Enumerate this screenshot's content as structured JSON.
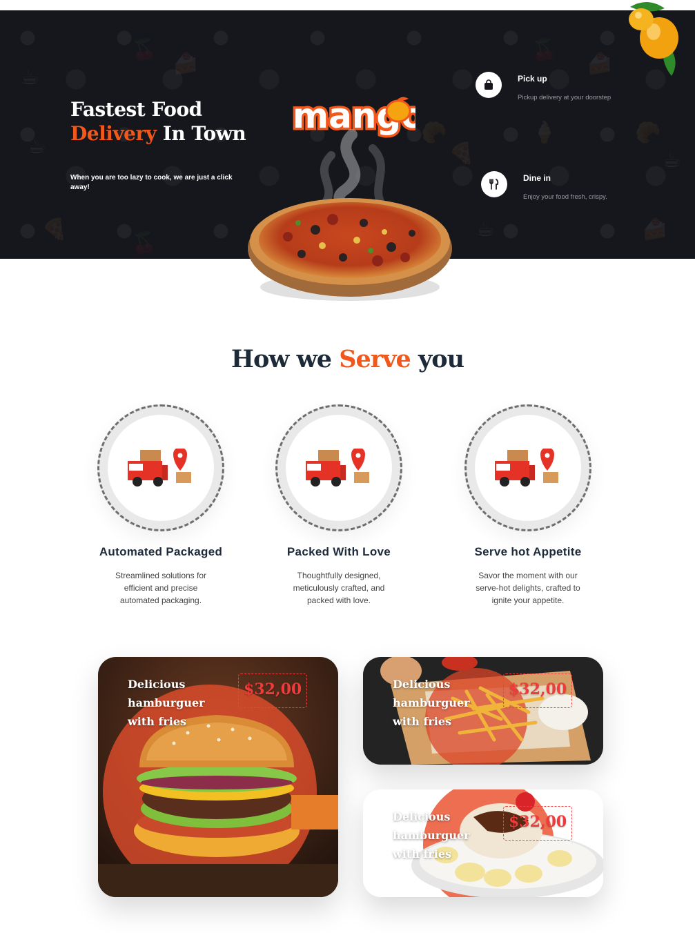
{
  "hero": {
    "title_line1": "Fastest Food",
    "title_accent": "Delivery",
    "title_rest": " In Town",
    "subtitle": "When you are too lazy to cook, we are just a click away!",
    "logo_text": "mango",
    "features": [
      {
        "icon": "shopping-bag-icon",
        "title": "Pick up",
        "description": "Pickup delivery at your doorstep"
      },
      {
        "icon": "fork-knife-icon",
        "title": "Dine in",
        "description": "Enjoy your food fresh, crispy."
      }
    ]
  },
  "serve": {
    "title_pre": "How we ",
    "title_accent": "Serve",
    "title_post": " you",
    "items": [
      {
        "icon": "delivery-truck-icon",
        "title": "Automated Packaged",
        "description": "Streamlined solutions for efficient and precise automated packaging."
      },
      {
        "icon": "delivery-truck-icon",
        "title": "Packed With Love",
        "description": "Thoughtfully designed, meticulously crafted, and packed with love."
      },
      {
        "icon": "delivery-truck-icon",
        "title": "Serve hot Appetite",
        "description": "Savor the moment with our serve-hot delights, crafted to ignite your appetite."
      }
    ]
  },
  "cards": [
    {
      "image": "hamburger-photo",
      "title": "Delicious hamburguer with fries",
      "price": "$32,00"
    },
    {
      "image": "fries-photo",
      "title": "Delicious hamburguer with fries",
      "price": "$32,00"
    },
    {
      "image": "ice-cream-banana-photo",
      "title": "Delicious hamburguer with fries",
      "price": "$32,00"
    }
  ],
  "colors": {
    "accent": "#f2581c",
    "dark": "#15171d",
    "heading": "#1d2a3a",
    "price": "#ee3b3b"
  }
}
